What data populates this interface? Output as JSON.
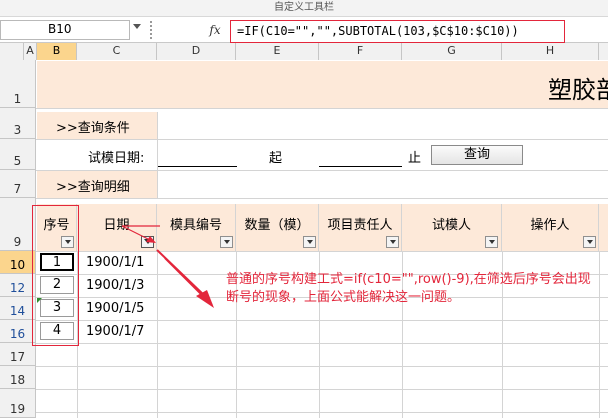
{
  "window": {
    "title": "自定义工具栏"
  },
  "formula_bar": {
    "name_box": "B10",
    "fx_label": "fx",
    "formula": "=IF(C10=\"\",\"\",SUBTOTAL(103,$C$10:$C10))"
  },
  "columns": [
    "A",
    "B",
    "C",
    "D",
    "E",
    "F",
    "G",
    "H"
  ],
  "rows": [
    "1",
    "3",
    "5",
    "7",
    "9",
    "10",
    "12",
    "14",
    "16",
    "17",
    "18",
    "19"
  ],
  "sheet": {
    "banner_title": "塑胶部",
    "query_condition": ">>查询条件",
    "trial_date_label": "试模日期:",
    "from_label": "起",
    "to_label": "止",
    "query_button": "查询",
    "query_detail": ">>查询明细"
  },
  "table": {
    "headers": [
      "序号",
      "日期",
      "模具编号",
      "数量（模）",
      "项目责任人",
      "试模人",
      "操作人"
    ],
    "rows": [
      {
        "seq": "1",
        "date": "1900/1/1"
      },
      {
        "seq": "2",
        "date": "1900/1/3"
      },
      {
        "seq": "3",
        "date": "1900/1/5"
      },
      {
        "seq": "4",
        "date": "1900/1/7"
      }
    ]
  },
  "annotation": "普通的序号构建工式=if(c10=\"\",row()-9),在筛选后序号会出现断号的现象，上面公式能解决这一问题。",
  "colors": {
    "accent_red": "#e3263b",
    "header_fill": "#fde9d9",
    "selected_header": "#fbd58d"
  }
}
